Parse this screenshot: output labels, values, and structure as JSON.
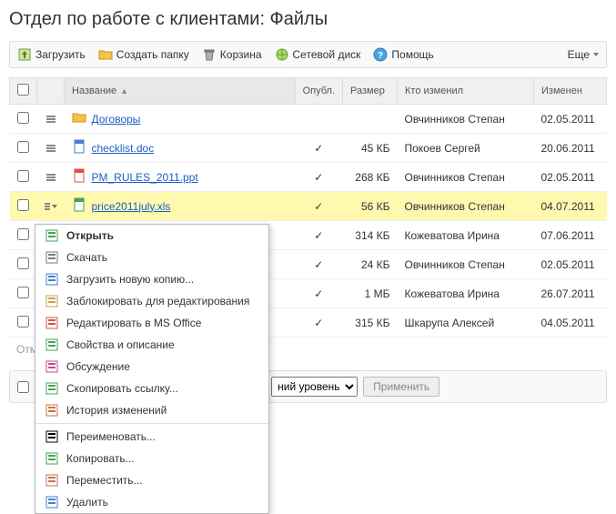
{
  "title": "Отдел по работе с клиентами: Файлы",
  "toolbar": {
    "upload": "Загрузить",
    "create_folder": "Создать папку",
    "trash": "Корзина",
    "network_disk": "Сетевой диск",
    "help": "Помощь",
    "more": "Еще"
  },
  "columns": {
    "name": "Название",
    "published": "Опубл.",
    "size": "Размер",
    "who": "Кто изменил",
    "changed": "Изменен"
  },
  "rows": [
    {
      "icon": "folder",
      "name": "Договоры",
      "pub": "",
      "size": "",
      "who": "Овчинников Степан",
      "date": "02.05.2011",
      "selected": false
    },
    {
      "icon": "doc",
      "name": "checklist.doc",
      "pub": "✓",
      "size": "45 КБ",
      "who": "Покоев Сергей",
      "date": "20.06.2011",
      "selected": false
    },
    {
      "icon": "ppt",
      "name": "PM_RULES_2011.ppt",
      "pub": "✓",
      "size": "268 КБ",
      "who": "Овчинников Степан",
      "date": "02.05.2011",
      "selected": false
    },
    {
      "icon": "xls",
      "name": "price2011july.xls",
      "pub": "✓",
      "size": "56 КБ",
      "who": "Овчинников Степан",
      "date": "04.07.2011",
      "selected": true
    },
    {
      "icon": "hidden",
      "name": "",
      "pub": "✓",
      "size": "314 КБ",
      "who": "Кожеватова Ирина",
      "date": "07.06.2011",
      "selected": false
    },
    {
      "icon": "hidden",
      "name": "",
      "pub": "✓",
      "size": "24 КБ",
      "who": "Овчинников Степан",
      "date": "02.05.2011",
      "selected": false
    },
    {
      "icon": "hidden",
      "name": "",
      "pub": "✓",
      "size": "1 МБ",
      "who": "Кожеватова Ирина",
      "date": "26.07.2011",
      "selected": false
    },
    {
      "icon": "hidden",
      "name": "",
      "pub": "✓",
      "size": "315 КБ",
      "who": "Шкарупа Алексей",
      "date": "04.05.2011",
      "selected": false
    }
  ],
  "marked_label": "Отм",
  "context_menu": [
    {
      "label": "Открыть",
      "bold": true
    },
    {
      "label": "Скачать"
    },
    {
      "label": "Загрузить новую копию..."
    },
    {
      "label": "Заблокировать для редактирования"
    },
    {
      "label": "Редактировать в MS Office"
    },
    {
      "label": "Свойства и описание"
    },
    {
      "label": "Обсуждение"
    },
    {
      "label": "Скопировать ссылку..."
    },
    {
      "label": "История изменений"
    },
    {
      "sep": true
    },
    {
      "label": "Переименовать..."
    },
    {
      "label": "Копировать..."
    },
    {
      "label": "Переместить..."
    },
    {
      "label": "Удалить"
    }
  ],
  "footer": {
    "select_partial": "ний уровень",
    "apply": "Применить"
  }
}
